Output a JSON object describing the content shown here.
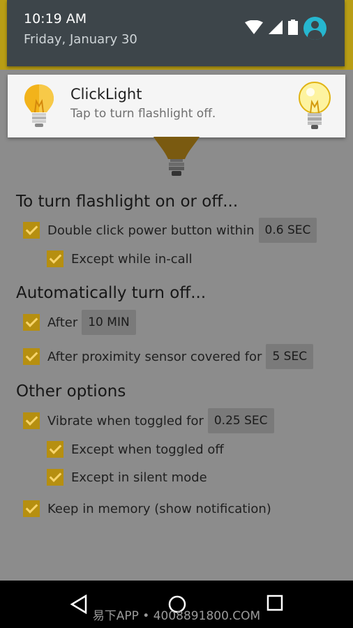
{
  "status": {
    "time": "10:19 AM",
    "date": "Friday, January 30"
  },
  "notification": {
    "title": "ClickLight",
    "text": "Tap to turn flashlight off."
  },
  "sections": {
    "turn_on_off": {
      "title": "To turn flashlight on or off...",
      "double_click": {
        "label": "Double click power button within",
        "value": "0.6 SEC"
      },
      "except_in_call": {
        "label": "Except while in-call"
      }
    },
    "auto_off": {
      "title": "Automatically turn off...",
      "after": {
        "label": "After",
        "value": "10 MIN"
      },
      "proximity": {
        "label": "After proximity sensor covered for",
        "value": "5 SEC"
      }
    },
    "other": {
      "title": "Other options",
      "vibrate": {
        "label": "Vibrate when toggled for",
        "value": "0.25 SEC"
      },
      "except_toggled_off": {
        "label": "Except when toggled off"
      },
      "except_silent": {
        "label": "Except in silent mode"
      },
      "keep_memory": {
        "label": "Keep in memory (show notification)"
      }
    }
  },
  "watermark": "易下APP • 4008891800.COM",
  "colors": {
    "accent": "#b68f10",
    "shade": "#3d454a",
    "avatar": "#26b6cf",
    "background_dim": "#8c8c8c"
  },
  "icons": [
    "wifi-icon",
    "signal-icon",
    "battery-icon",
    "user-avatar-icon",
    "lightbulb-icon",
    "back-icon",
    "home-icon",
    "recents-icon"
  ]
}
